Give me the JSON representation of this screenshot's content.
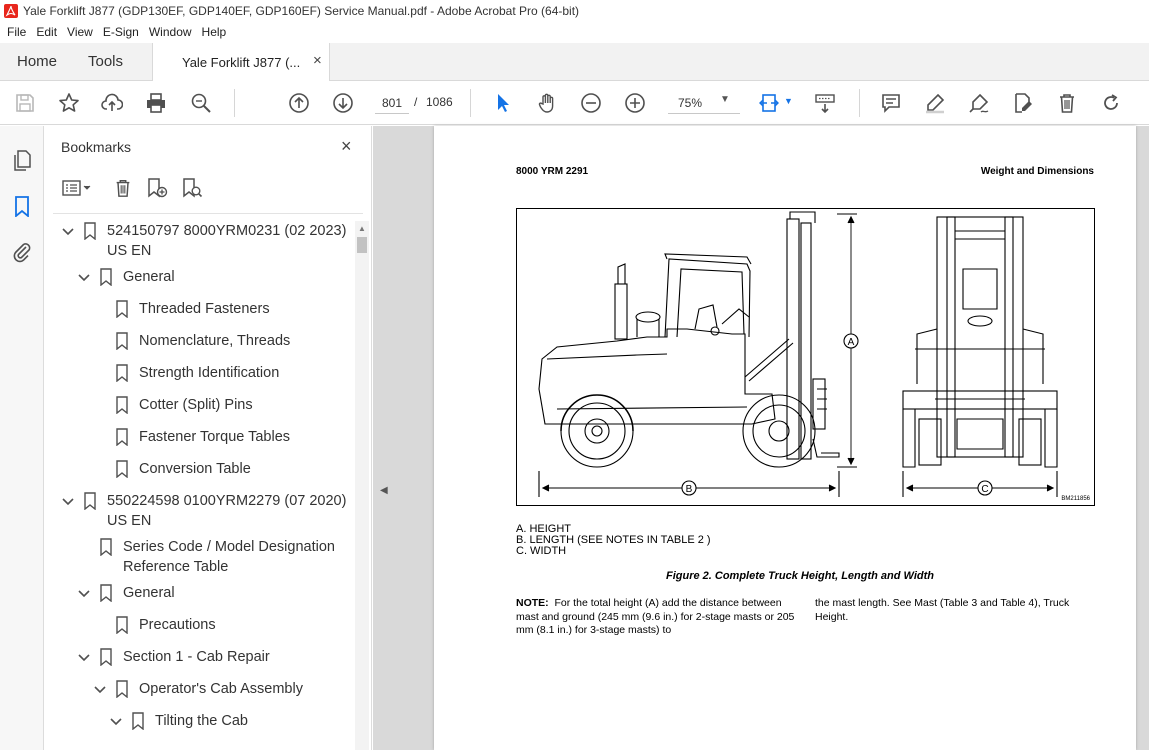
{
  "window": {
    "title": "Yale Forklift J877 (GDP130EF, GDP140EF, GDP160EF) Service Manual.pdf - Adobe Acrobat Pro (64-bit)"
  },
  "menu": [
    "File",
    "Edit",
    "View",
    "E-Sign",
    "Window",
    "Help"
  ],
  "tabs": {
    "home": "Home",
    "tools": "Tools",
    "document": "Yale Forklift J877 (...",
    "close": "×"
  },
  "toolbar": {
    "current_page": "801",
    "page_separator": "/",
    "total_pages": "1086",
    "zoom": "75%"
  },
  "bookmarks": {
    "title": "Bookmarks",
    "close": "×",
    "items": [
      {
        "label": "524150797 8000YRM0231 (02 2023)",
        "label2": "US EN",
        "level": 0,
        "expanded": true
      },
      {
        "label": "General",
        "level": 1,
        "expanded": true
      },
      {
        "label": "Threaded Fasteners",
        "level": 2
      },
      {
        "label": "Nomenclature, Threads",
        "level": 2
      },
      {
        "label": "Strength Identification",
        "level": 2
      },
      {
        "label": "Cotter (Split) Pins",
        "level": 2
      },
      {
        "label": "Fastener Torque Tables",
        "level": 2
      },
      {
        "label": "Conversion Table",
        "level": 2
      },
      {
        "label": "550224598 0100YRM2279 (07 2020)",
        "label2": "US EN",
        "level": 0,
        "expanded": true
      },
      {
        "label": "Series Code / Model Designation",
        "label2": "Reference Table",
        "level": 1
      },
      {
        "label": "General",
        "level": 1,
        "expanded": true
      },
      {
        "label": "Precautions",
        "level": 2
      },
      {
        "label": "Section 1 - Cab Repair",
        "level": 1,
        "expanded": true
      },
      {
        "label": "Operator's Cab Assembly",
        "level": 2,
        "expanded": true
      },
      {
        "label": "Tilting the Cab",
        "level": 3,
        "expanded": true
      }
    ]
  },
  "document": {
    "header_left": "8000 YRM 2291",
    "header_right": "Weight and Dimensions",
    "figure_code": "BM211856",
    "dimension_labels": {
      "a": "A",
      "b": "B",
      "c": "C"
    },
    "legend": [
      "A.   HEIGHT",
      "B.   LENGTH (SEE NOTES IN TABLE 2 )",
      "C.   WIDTH"
    ],
    "caption": "Figure 2. Complete Truck Height, Length and Width",
    "note_label": "NOTE:",
    "note_left": "For the total height (A) add the distance between mast and ground (245 mm (9.6 in.) for 2-stage masts or 205 mm (8.1 in.) for 3-stage masts) to",
    "note_right": "the mast length. See Mast (Table 3 and Table 4), Truck Height."
  },
  "colors": {
    "accent_blue": "#1473e6",
    "acrobat_red": "#e8261c",
    "icon_gray": "#505050"
  }
}
